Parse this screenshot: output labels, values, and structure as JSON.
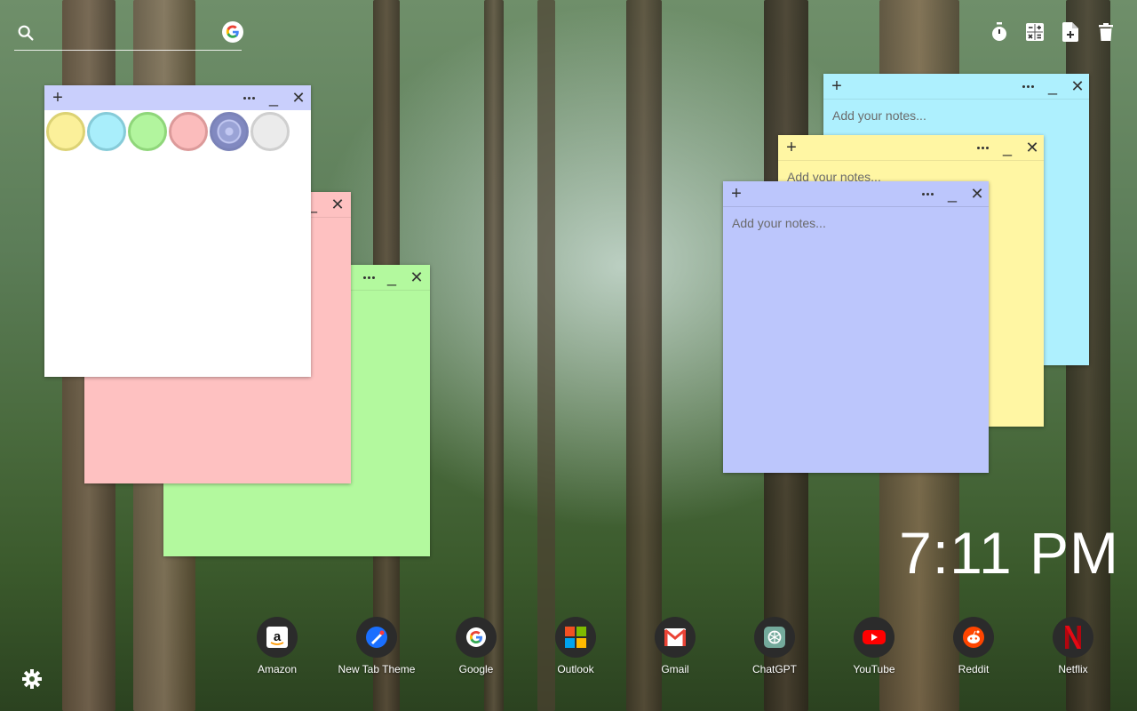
{
  "search": {
    "placeholder": ""
  },
  "toolbar": {
    "icons": [
      "timer-icon",
      "calculator-icon",
      "new-note-icon",
      "trash-icon"
    ]
  },
  "notes": {
    "palette": {
      "colors": [
        "#fbf09a",
        "#a9eefb",
        "#b2f59e",
        "#fbbcbc",
        "#9aa3d6",
        "#ebebeb"
      ],
      "selected_index": 4
    },
    "pink": {
      "color": "#fec1c1"
    },
    "green": {
      "color": "#b3f99e"
    },
    "cyan": {
      "color": "#aef0fe",
      "placeholder": "Add your notes..."
    },
    "yellow": {
      "color": "#fff6a3",
      "placeholder": "Add your notes..."
    },
    "blue": {
      "color": "#bcc6fc",
      "placeholder": "Add your notes..."
    }
  },
  "clock": {
    "time": "7:11 PM"
  },
  "dock": {
    "apps": [
      {
        "label": "Amazon"
      },
      {
        "label": "New Tab Theme"
      },
      {
        "label": "Google"
      },
      {
        "label": "Outlook"
      },
      {
        "label": "Gmail"
      },
      {
        "label": "ChatGPT"
      },
      {
        "label": "YouTube"
      },
      {
        "label": "Reddit"
      },
      {
        "label": "Netflix"
      }
    ]
  }
}
